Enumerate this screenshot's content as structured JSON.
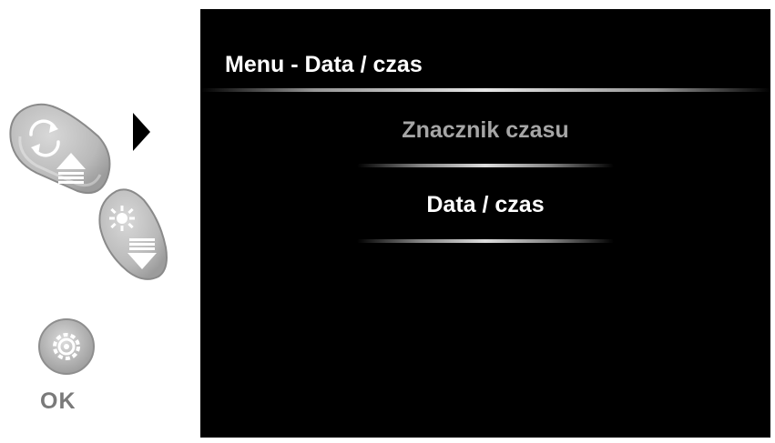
{
  "screen": {
    "title": "Menu - Data / czas",
    "items": [
      {
        "label": "Znacznik czasu",
        "state": "inactive"
      },
      {
        "label": "Data / czas",
        "state": "highlighted"
      }
    ]
  },
  "controls": {
    "rotate_up_button": {
      "icons": [
        "rotate-icon",
        "up-arrow-icon"
      ]
    },
    "brightness_down_button": {
      "icons": [
        "brightness-icon",
        "down-arrow-icon"
      ]
    },
    "ok_button": {
      "icon": "gear-icon",
      "label": "OK"
    },
    "selection_indicator": "right-triangle-icon"
  },
  "colors": {
    "screen_bg": "#000000",
    "title_text": "#ffffff",
    "inactive_item": "#a6a6a6",
    "active_item": "#ffffff",
    "button_gray": "#b8b8b8",
    "ok_label": "#7a7a7a"
  }
}
